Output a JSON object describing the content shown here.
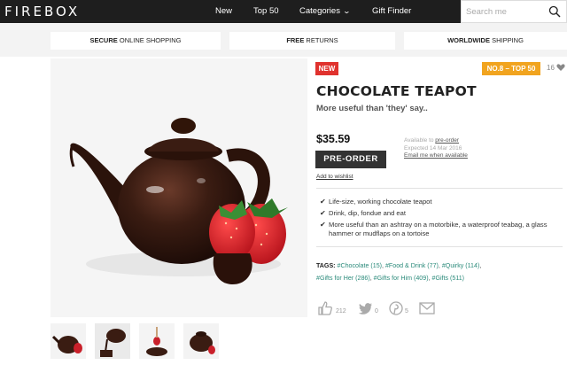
{
  "header": {
    "logo": "FIREBOX",
    "nav": {
      "new": "New",
      "top50": "Top 50",
      "categories": "Categories",
      "gift_finder": "Gift Finder"
    },
    "search_placeholder": "Search me"
  },
  "features_strip": [
    {
      "bold": "SECURE",
      "rest": " ONLINE SHOPPING"
    },
    {
      "bold": "FREE",
      "rest": " RETURNS"
    },
    {
      "bold": "WORLDWIDE",
      "rest": " SHIPPING"
    }
  ],
  "product": {
    "badge_new": "NEW",
    "badge_rank": "NO.8 – TOP 50",
    "favorites": "16",
    "title": "CHOCOLATE TEAPOT",
    "subtitle": "More useful than 'they' say..",
    "price": "$35.59",
    "preorder_label": "PRE-ORDER",
    "wishlist": "Add to wishlist",
    "availability": {
      "line1_prefix": "Available to ",
      "line1_link": "pre-order",
      "line2": "Expected 14 Mar 2016",
      "line3": "Email me when available"
    },
    "bullets": [
      "Life-size, working chocolate teapot",
      "Drink, dip, fondue and eat",
      "More useful than an ashtray on a motorbike, a waterproof teabag, a glass hammer or mudflaps on a tortoise"
    ],
    "tags_label": "TAGS:",
    "tags": [
      "#Chocolate (15)",
      "#Food & Drink (77)",
      "#Quirky (114)",
      "#Gifts for Her (286)",
      "#Gifts for Him (409)",
      "#Gifts (511)"
    ],
    "social": {
      "likes": "212",
      "tweets": "0",
      "pins": "5"
    }
  },
  "colors": {
    "nav_bg": "#1e1e1e",
    "badge_new": "#e0322e",
    "badge_rank": "#f1a41f",
    "button_bg": "#333333",
    "tag_link": "#2a8a7a"
  }
}
